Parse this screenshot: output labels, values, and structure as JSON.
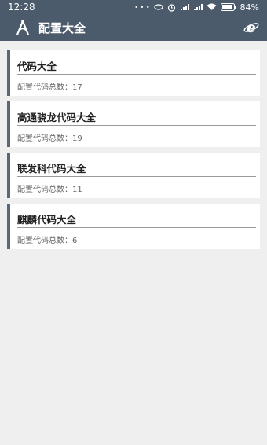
{
  "status_bar": {
    "time": "12:28",
    "dots": "• • •",
    "battery": "84%"
  },
  "app_bar": {
    "title": "配置大全",
    "logo_icon": "compass-a-logo-icon",
    "right_icon": "ie-browser-icon"
  },
  "items": [
    {
      "title": "代码大全",
      "meta": "配置代码总数：17"
    },
    {
      "title": "高通骁龙代码大全",
      "meta": "配置代码总数：19"
    },
    {
      "title": "联发科代码大全",
      "meta": "配置代码总数：11"
    },
    {
      "title": "麒麟代码大全",
      "meta": "配置代码总数：6"
    }
  ],
  "colors": {
    "header": "#4b5b6b",
    "accent_bar": "#576879",
    "background": "#efefef"
  }
}
